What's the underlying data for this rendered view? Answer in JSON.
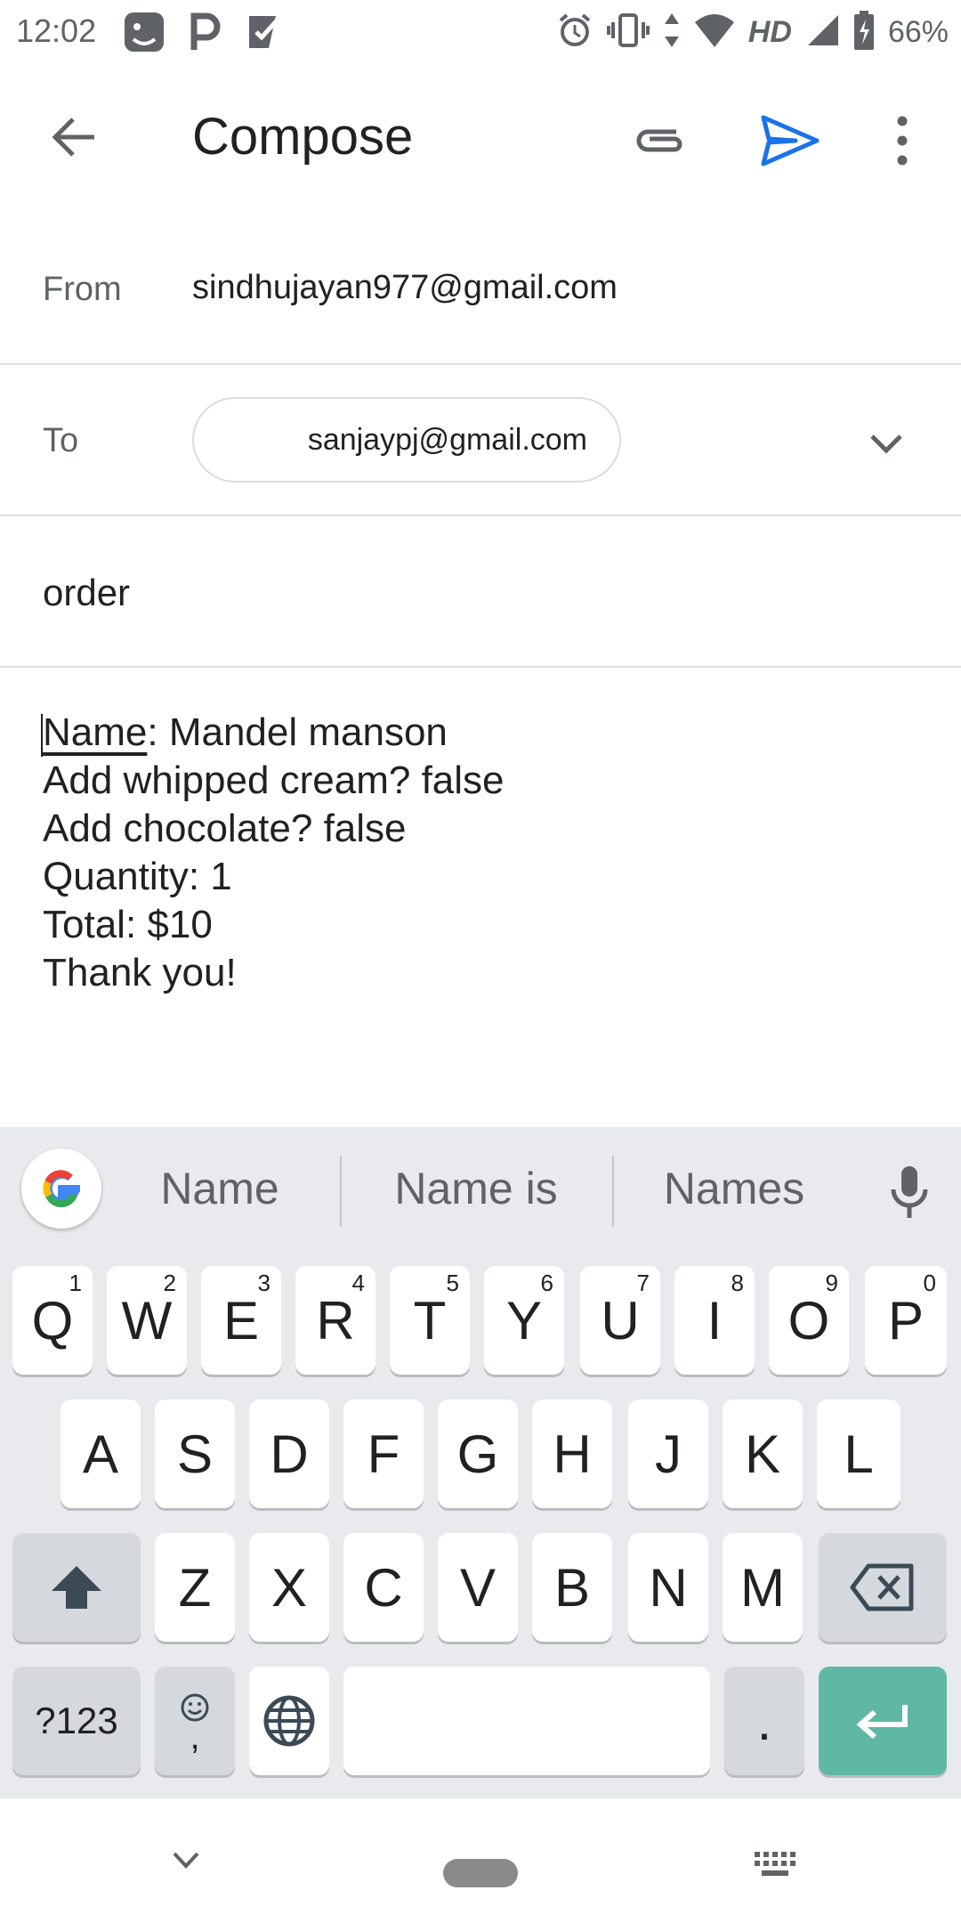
{
  "status_bar": {
    "time": "12:02",
    "left_icons": [
      "stickers-app-icon",
      "p-app-icon",
      "tasks-app-icon"
    ],
    "right_icons": [
      "alarm-icon",
      "vibrate-icon",
      "data-arrows-icon",
      "wifi-icon",
      "hd-badge",
      "signal-icon",
      "battery-charging-icon"
    ],
    "hd_label": "HD",
    "battery": "66%"
  },
  "toolbar": {
    "title": "Compose",
    "accent_color": "#1a73e8"
  },
  "compose": {
    "from_label": "From",
    "from_value": "sindhujayan977@gmail.com",
    "to_label": "To",
    "to_chip": "sanjaypj@gmail.com",
    "subject": "order",
    "body_first_word": "Name",
    "body_first_rest": ": Mandel manson",
    "body_lines": [
      "Add whipped cream? false",
      "Add chocolate? false",
      "Quantity: 1",
      "Total: $10",
      "Thank you!"
    ]
  },
  "keyboard": {
    "suggestions": [
      "Name",
      "Name is",
      "Names"
    ],
    "row1": [
      {
        "key": "Q",
        "hint": "1"
      },
      {
        "key": "W",
        "hint": "2"
      },
      {
        "key": "E",
        "hint": "3"
      },
      {
        "key": "R",
        "hint": "4"
      },
      {
        "key": "T",
        "hint": "5"
      },
      {
        "key": "Y",
        "hint": "6"
      },
      {
        "key": "U",
        "hint": "7"
      },
      {
        "key": "I",
        "hint": "8"
      },
      {
        "key": "O",
        "hint": "9"
      },
      {
        "key": "P",
        "hint": "0"
      }
    ],
    "row2": [
      "A",
      "S",
      "D",
      "F",
      "G",
      "H",
      "J",
      "K",
      "L"
    ],
    "row3": [
      "Z",
      "X",
      "C",
      "V",
      "B",
      "N",
      "M"
    ],
    "symbols_label": "?123",
    "comma_label": ",",
    "period_label": ".",
    "enter_color": "#5fb8a4"
  }
}
